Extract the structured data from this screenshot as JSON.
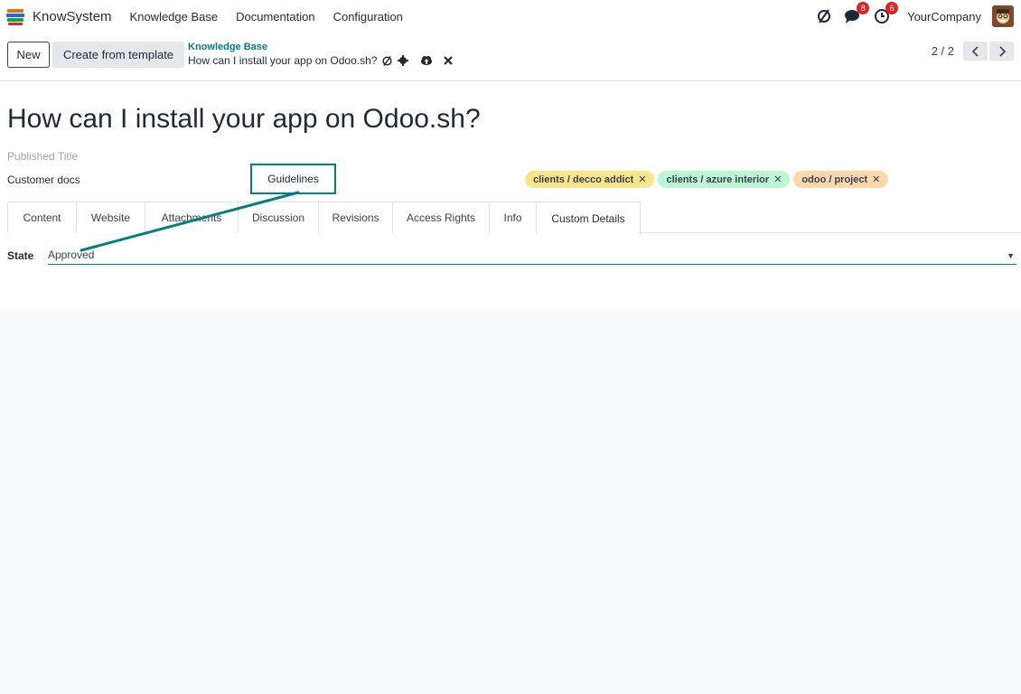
{
  "app": {
    "name": "KnowSystem"
  },
  "menu": [
    "Knowledge Base",
    "Documentation",
    "Configuration"
  ],
  "systray": {
    "messages_badge": "8",
    "activities_badge": "6",
    "company": "YourCompany"
  },
  "actions": {
    "new_label": "New",
    "template_label": "Create from template"
  },
  "breadcrumb": {
    "parent": "Knowledge Base",
    "current": "How can I install your app on Odoo.sh?"
  },
  "pager": {
    "value": "2 / 2"
  },
  "record": {
    "title": "How can I install your app on Odoo.sh?",
    "published_title_placeholder": "Published Title",
    "section": "Customer docs",
    "guideline": "Guidelines",
    "tags": [
      {
        "label": "clients / decco addict",
        "color": "#fde68a"
      },
      {
        "label": "clients / azure interior",
        "color": "#bbf7d0"
      },
      {
        "label": "odoo / project",
        "color": "#fed7aa"
      }
    ]
  },
  "tabs": [
    "Content",
    "Website",
    "Attachments",
    "Discussion",
    "Revisions",
    "Access Rights",
    "Info",
    "Custom Details"
  ],
  "active_tab": "Custom Details",
  "custom": {
    "state_label": "State",
    "state_value": "Approved"
  },
  "colors": {
    "accent": "#017e84",
    "badge": "#dc2626",
    "annotation": "#017e84"
  }
}
